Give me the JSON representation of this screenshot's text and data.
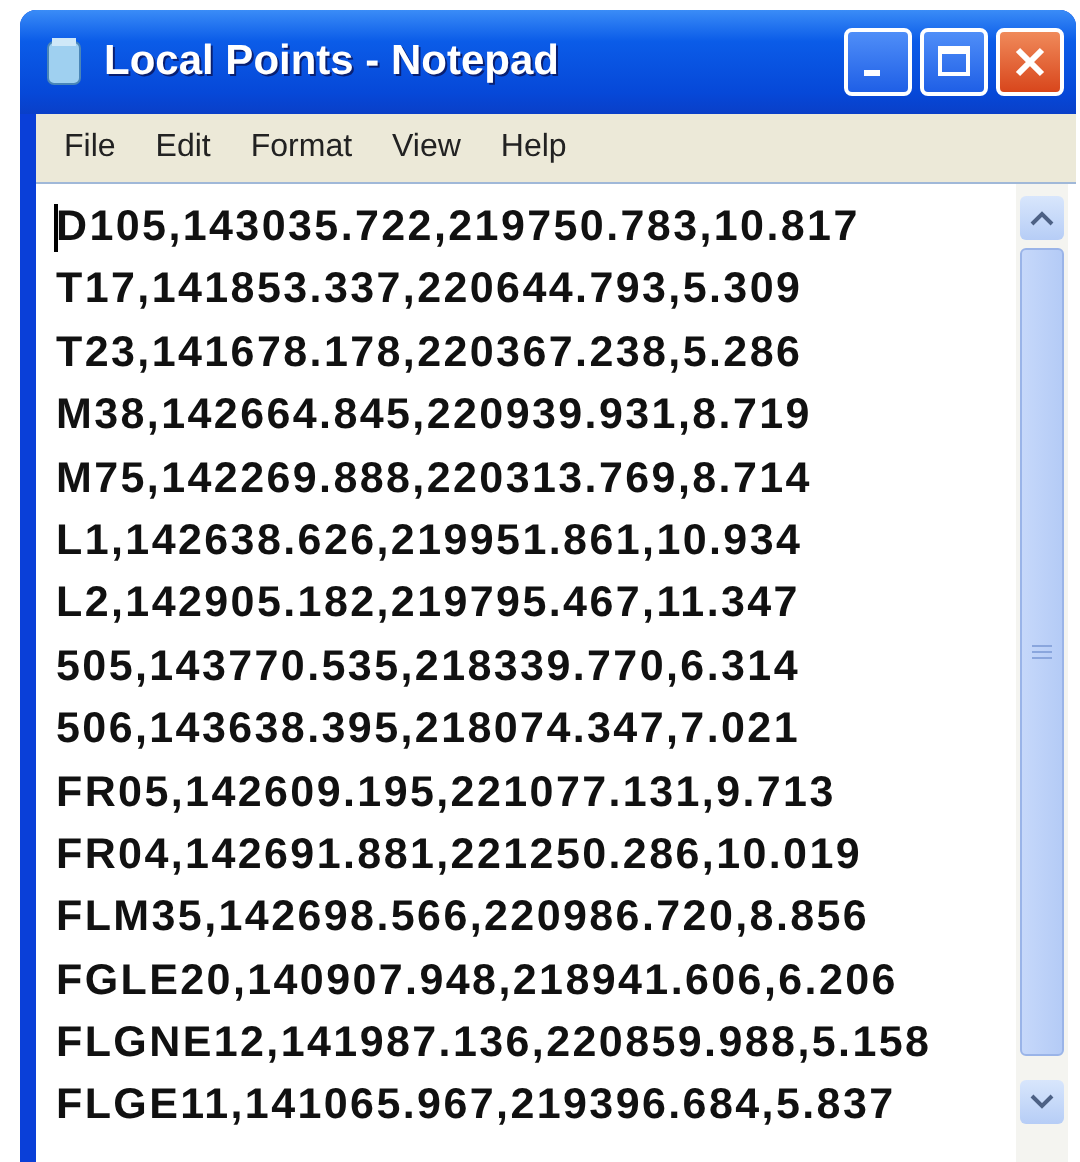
{
  "window": {
    "title": "Local Points - Notepad"
  },
  "menu": [
    "File",
    "Edit",
    "Format",
    "View",
    "Help"
  ],
  "lines": [
    "D105,143035.722,219750.783,10.817",
    "T17,141853.337,220644.793,5.309",
    "T23,141678.178,220367.238,5.286",
    "M38,142664.845,220939.931,8.719",
    "M75,142269.888,220313.769,8.714",
    "L1,142638.626,219951.861,10.934",
    "L2,142905.182,219795.467,11.347",
    "505,143770.535,218339.770,6.314",
    "506,143638.395,218074.347,7.021",
    "FR05,142609.195,221077.131,9.713",
    "FR04,142691.881,221250.286,10.019",
    "FLM35,142698.566,220986.720,8.856",
    "FGLE20,140907.948,218941.606,6.206",
    "FLGNE12,141987.136,220859.988,5.158",
    "FLGE11,141065.967,219396.684,5.837"
  ]
}
